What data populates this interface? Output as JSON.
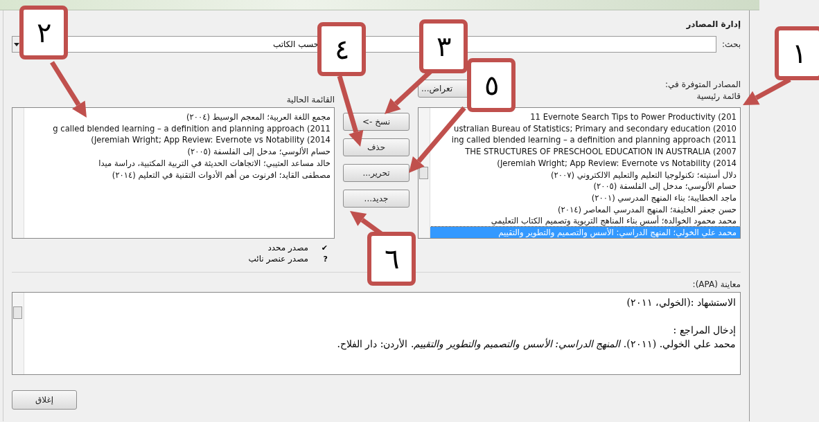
{
  "window": {
    "title": "إدارة المصادر"
  },
  "search": {
    "label": "بحث:",
    "sort_value": "حسب الكاتب"
  },
  "available": {
    "label": "المصادر المتوفرة في:",
    "list_name": "قائمة رئيسية",
    "browse_button": "تعراض...",
    "items": [
      {
        "text": "11 Evernote Search Tips to Power Productivity (201",
        "selected": false
      },
      {
        "text": "ustralian Bureau of Statistics; Primary and secondary education (2010",
        "selected": false
      },
      {
        "text": "ing called blended learning – a definition and planning approach (2011",
        "selected": false
      },
      {
        "text": "THE STRUCTURES OF PRESCHOOL EDUCATION IN AUSTRALIA  (2007",
        "selected": false
      },
      {
        "text": "(Jeremiah Wright; App Review: Evernote vs Notability (2014",
        "selected": false
      },
      {
        "text": "دلال أستيته؛ تكنولوجيا التعليم والتعليم الالكتروني (٢٠٠٧)",
        "selected": false
      },
      {
        "text": "حسام الألوسي؛ مدخل إلى الفلسفة (٢٠٠٥)",
        "selected": false
      },
      {
        "text": "ماجد الخطايبة؛ بناء المنهج المدرسي (٢٠٠١)",
        "selected": false
      },
      {
        "text": "حسن جعفر الخليفة؛ المنهج المدرسي المعاصر (٢٠١٤)",
        "selected": false
      },
      {
        "text": "محمد محمود الخوالدة؛ أسس بناء المناهج التربوية وتصميم الكتاب التعليمي",
        "selected": false
      },
      {
        "text": "محمد علي الخولي؛ المنهج الدراسي: الأسس والتصميم والتطوير والتقييم",
        "selected": true
      }
    ]
  },
  "actions": [
    "نسخ ->",
    "حذف",
    "تحرير...",
    "جديد..."
  ],
  "current": {
    "label": "القائمة الحالية",
    "items": [
      {
        "text": "مجمع اللغة العربية؛ المعجم الوسيط (٢٠٠٤)"
      },
      {
        "text": "g called blended learning – a definition and planning approach (2011"
      },
      {
        "text": "(Jeremiah Wright; App Review: Evernote vs Notability (2014"
      },
      {
        "text": "حسام الألوسي؛ مدخل إلى الفلسفة (٢٠٠٥)"
      },
      {
        "text": "خالد مساعد العتيبي؛ الاتجاهات الحديثة في التربية المكتبية، دراسة ميدا"
      },
      {
        "text": "مصطفى القايد؛ افرنوت من أهم الأدوات التقنية في التعليم (٢٠١٤)"
      }
    ]
  },
  "legend": [
    {
      "symbol": "✔",
      "text": "مصدر محدد"
    },
    {
      "symbol": "?",
      "text": "مصدر عنصر نائب"
    }
  ],
  "preview": {
    "label": "معاينة (APA):",
    "citation": "الاستشهاد :(الخولي، ٢٠١١)",
    "bibliography_label": "إدخال المراجع :",
    "reference": "محمد علي الخولي. (٢٠١١). *المنهج الدراسي: الأسس والتصميم والتطوير والتقييم*. الأردن: دار الفلاح."
  },
  "close_button": "إغلاق",
  "callouts": [
    "١",
    "٢",
    "٣",
    "٤",
    "٥",
    "٦"
  ]
}
